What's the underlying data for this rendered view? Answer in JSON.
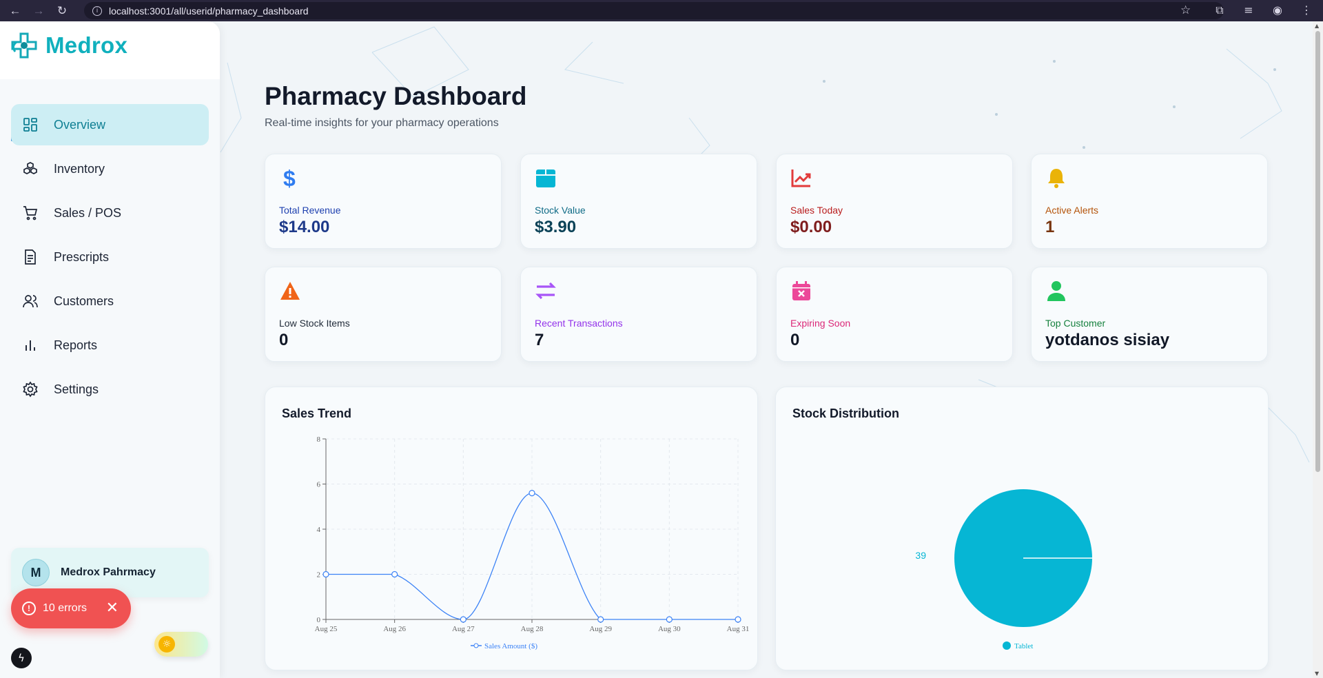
{
  "browser": {
    "url": "localhost:3001/all/userid/pharmacy_dashboard"
  },
  "app": {
    "name": "Medrox"
  },
  "sidebar": {
    "items": [
      {
        "label": "Overview",
        "icon": "grid-icon",
        "active": true
      },
      {
        "label": "Inventory",
        "icon": "boxes-icon"
      },
      {
        "label": "Sales / POS",
        "icon": "cart-icon"
      },
      {
        "label": "Prescripts",
        "icon": "document-icon"
      },
      {
        "label": "Customers",
        "icon": "users-icon"
      },
      {
        "label": "Reports",
        "icon": "bar-chart-icon"
      },
      {
        "label": "Settings",
        "icon": "gear-icon"
      }
    ],
    "profile": {
      "initial": "M",
      "name": "Medrox Pahrmacy"
    }
  },
  "errors": {
    "label": "10 errors"
  },
  "header": {
    "title": "Pharmacy Dashboard",
    "subtitle": "Real-time insights for your pharmacy operations"
  },
  "stats": [
    {
      "label": "Total Revenue",
      "value": "$14.00",
      "icon": "dollar-icon",
      "label_color": "#1e40af",
      "value_color": "#1e3a8a",
      "icon_color": "#2f7cf0"
    },
    {
      "label": "Stock Value",
      "value": "$3.90",
      "icon": "box-icon",
      "label_color": "#0f6b86",
      "value_color": "#0b4257",
      "icon_color": "#06b6d4"
    },
    {
      "label": "Sales Today",
      "value": "$0.00",
      "icon": "trending-up-icon",
      "label_color": "#b91c1c",
      "value_color": "#7f1d1d",
      "icon_color": "#e23b3b"
    },
    {
      "label": "Active Alerts",
      "value": "1",
      "icon": "bell-icon",
      "label_color": "#b45309",
      "value_color": "#78350f",
      "icon_color": "#eab308"
    },
    {
      "label": "Low Stock Items",
      "value": "0",
      "icon": "warning-icon",
      "label_color": "#1f2937",
      "value_color": "#111827",
      "icon_color": "#f06418"
    },
    {
      "label": "Recent Transactions",
      "value": "7",
      "icon": "exchange-icon",
      "label_color": "#9333ea",
      "value_color": "#111827",
      "icon_color": "#a855f7"
    },
    {
      "label": "Expiring Soon",
      "value": "0",
      "icon": "calendar-x-icon",
      "label_color": "#db2777",
      "value_color": "#111827",
      "icon_color": "#ec4899"
    },
    {
      "label": "Top Customer",
      "value": "yotdanos sisiay",
      "icon": "user-icon",
      "label_color": "#15803d",
      "value_color": "#111827",
      "icon_color": "#22c55e"
    }
  ],
  "sales_trend": {
    "title": "Sales Trend",
    "legend": "Sales Amount ($)"
  },
  "stock_distribution": {
    "title": "Stock Distribution",
    "legend": "Tablet",
    "slice_label": "39"
  },
  "chart_data": [
    {
      "type": "line",
      "title": "Sales Trend",
      "x": [
        "Aug 25",
        "Aug 26",
        "Aug 27",
        "Aug 28",
        "Aug 29",
        "Aug 30",
        "Aug 31"
      ],
      "series": [
        {
          "name": "Sales Amount ($)",
          "values": [
            2,
            2,
            0,
            5.6,
            0,
            0,
            0
          ],
          "color": "#3b82f6"
        }
      ],
      "yticks": [
        0,
        2,
        4,
        6,
        8
      ],
      "ylim": [
        0,
        8
      ],
      "grid": true,
      "legend": "bottom"
    },
    {
      "type": "pie",
      "title": "Stock Distribution",
      "categories": [
        "Tablet"
      ],
      "values": [
        39
      ],
      "colors": [
        "#06b6d4"
      ],
      "legend": "bottom"
    }
  ]
}
